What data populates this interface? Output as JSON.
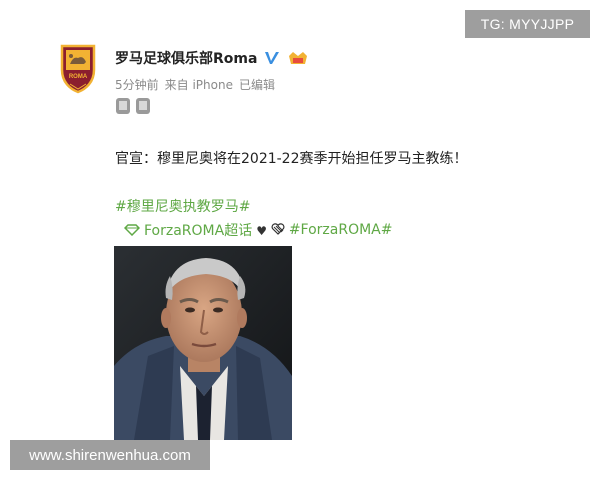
{
  "overlay": {
    "tg_label": "TG: MYYJJPP",
    "site_watermark": "www.shirenwenhua.com"
  },
  "post": {
    "account_name": "罗马足球俱乐部Roma",
    "meta": {
      "time": "5分钟前",
      "source": "来自 iPhone",
      "edited": "已编辑"
    },
    "text": "官宣：穆里尼奥将在2021-22赛季开始担任罗马主教练！",
    "hashtag": "#穆里尼奥执教罗马#",
    "topic": {
      "link_label": "ForzaROMA超话",
      "hearts": "♥",
      "hashtag": "#ForzaROMA#"
    }
  },
  "colors": {
    "link_green": "#5fa845",
    "roma_maroon": "#8b1e2e",
    "roma_gold": "#f2b233",
    "verified_blue": "#3a8fe0",
    "overlay_gray": "#9e9e9e"
  },
  "icons": {
    "avatar": "as-roma-crest",
    "verified": "verified-v-icon",
    "member": "vip-member-icon",
    "fans_badges": [
      "fan-badge-icon",
      "fan-badge-icon"
    ],
    "topic": "supertopic-diamond-icon"
  }
}
